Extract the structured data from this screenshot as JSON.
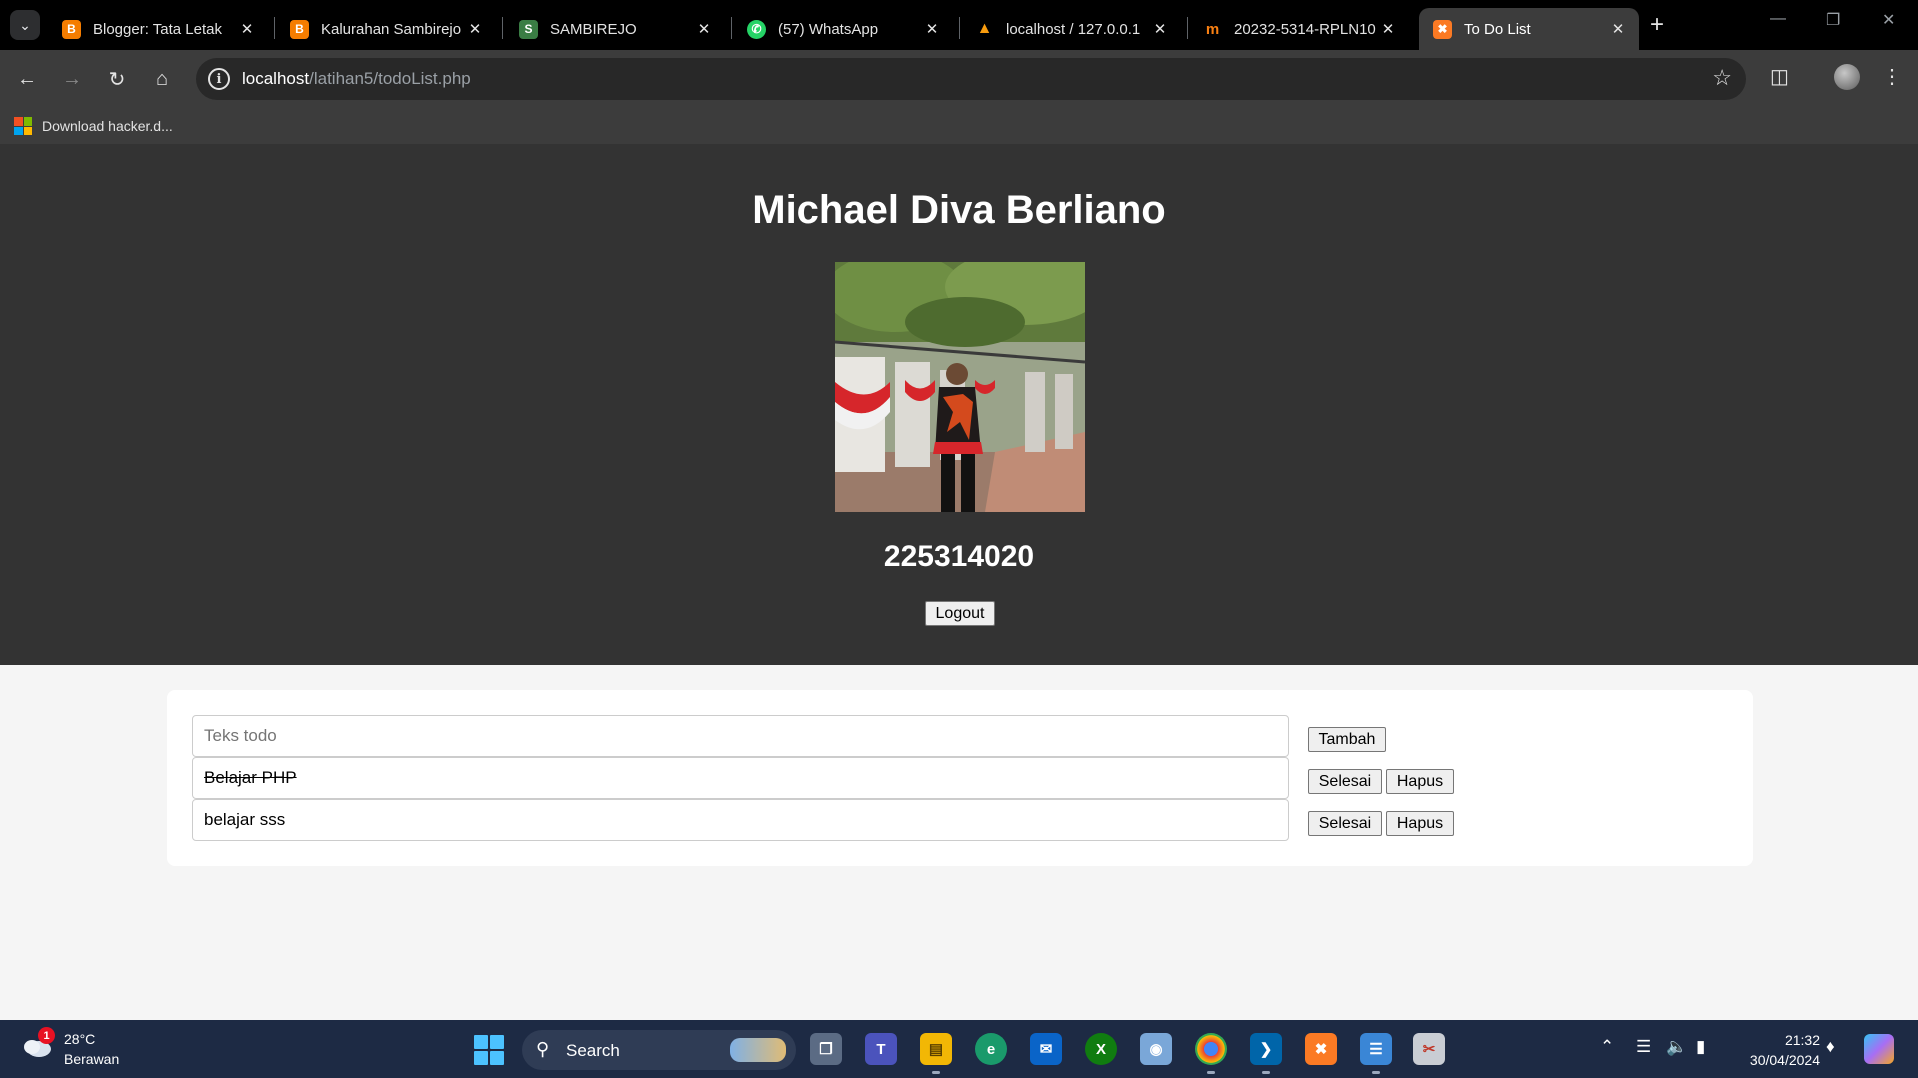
{
  "browser": {
    "tabs": [
      {
        "title": "Blogger: Tata Letak",
        "icon": "blogger-icon",
        "color": "#f57d00"
      },
      {
        "title": "Kalurahan Sambirejo",
        "icon": "blogger-icon",
        "color": "#f57d00"
      },
      {
        "title": "SAMBIREJO",
        "icon": "site-icon",
        "color": "#3a7d44"
      },
      {
        "title": "(57) WhatsApp",
        "icon": "whatsapp-icon",
        "color": "#25d366"
      },
      {
        "title": "localhost / 127.0.0.1",
        "icon": "phpmyadmin-icon",
        "color": "#f89c0e"
      },
      {
        "title": "20232-5314-RPLN10",
        "icon": "moodle-icon",
        "color": "#f98012"
      },
      {
        "title": "To Do List",
        "icon": "xampp-icon",
        "color": "#fb7a24",
        "active": true
      }
    ],
    "address": {
      "host": "localhost",
      "path": "/latihan5/todoList.php"
    },
    "bookmarks": [
      {
        "label": "Download hacker.d..."
      }
    ]
  },
  "page": {
    "name": "Michael Diva Berliano",
    "student_id": "225314020",
    "logout_label": "Logout",
    "photo_alt": "profile photo",
    "new_todo": {
      "placeholder": "Teks todo",
      "value": "",
      "add_label": "Tambah"
    },
    "todos": [
      {
        "text": "Belajar PHP",
        "done": true,
        "done_label": "Selesai",
        "delete_label": "Hapus"
      },
      {
        "text": "belajar sss",
        "done": false,
        "done_label": "Selesai",
        "delete_label": "Hapus"
      }
    ]
  },
  "taskbar": {
    "weather": {
      "temp": "28°C",
      "desc": "Berawan",
      "badge": "1"
    },
    "search_label": "Search",
    "time": "21:32",
    "date": "30/04/2024"
  },
  "colors": {
    "header_bg": "#333333",
    "page_bg": "#f5f5f5",
    "taskbar_bg": "#1d2a44",
    "accent": "#4cc2ff"
  }
}
